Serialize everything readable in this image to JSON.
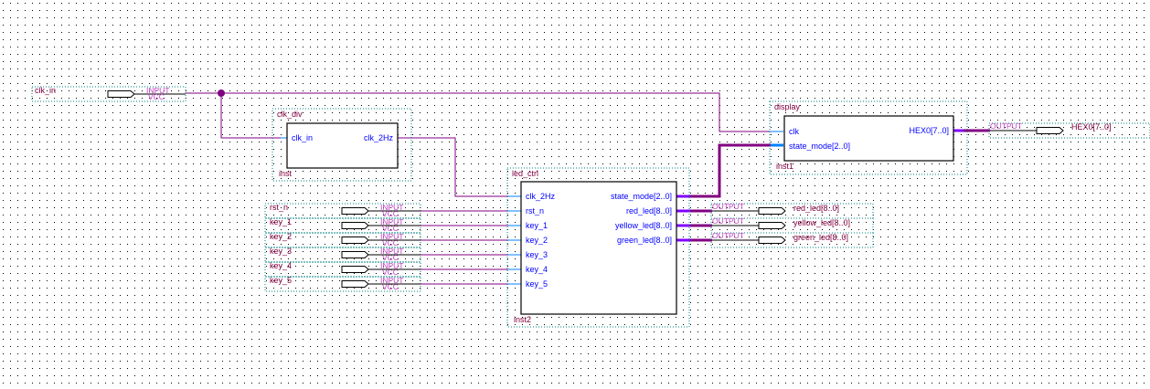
{
  "colors": {
    "wire": "#800080",
    "port_stub": "#0080ff",
    "port_text": "#0000ff",
    "label_text": "#800040",
    "grid_dot": "#000000"
  },
  "input_pins": [
    {
      "name": "clk_in",
      "type": "INPUT",
      "default": "VCC"
    },
    {
      "name": "rst_n",
      "type": "INPUT",
      "default": "VCC"
    },
    {
      "name": "key_1",
      "type": "INPUT",
      "default": "VCC"
    },
    {
      "name": "key_2",
      "type": "INPUT",
      "default": "VCC"
    },
    {
      "name": "key_3",
      "type": "INPUT",
      "default": "VCC"
    },
    {
      "name": "key_4",
      "type": "INPUT",
      "default": "VCC"
    },
    {
      "name": "key_5",
      "type": "INPUT",
      "default": "VCC"
    }
  ],
  "output_pins": [
    {
      "name": "HEX0[7..0]",
      "type": "OUTPUT"
    },
    {
      "name": "red_led[8..0]",
      "type": "OUTPUT"
    },
    {
      "name": "yellow_led[8..0]",
      "type": "OUTPUT"
    },
    {
      "name": "green_led[8..0]",
      "type": "OUTPUT"
    }
  ],
  "blocks": {
    "clk_div": {
      "module": "clk_div",
      "instance": "inst",
      "inputs": [
        "clk_in"
      ],
      "outputs": [
        "clk_2Hz"
      ]
    },
    "led_ctrl": {
      "module": "led_ctrl",
      "instance": "inst2",
      "inputs": [
        "clk_2Hz",
        "rst_n",
        "key_1",
        "key_2",
        "key_3",
        "key_4",
        "key_5"
      ],
      "outputs": [
        "state_mode[2..0]",
        "red_led[8..0]",
        "yellow_led[8..0]",
        "green_led[8..0]"
      ]
    },
    "display": {
      "module": "display",
      "instance": "inst1",
      "inputs": [
        "clk",
        "state_mode[2..0]"
      ],
      "outputs": [
        "HEX0[7..0]"
      ]
    }
  }
}
